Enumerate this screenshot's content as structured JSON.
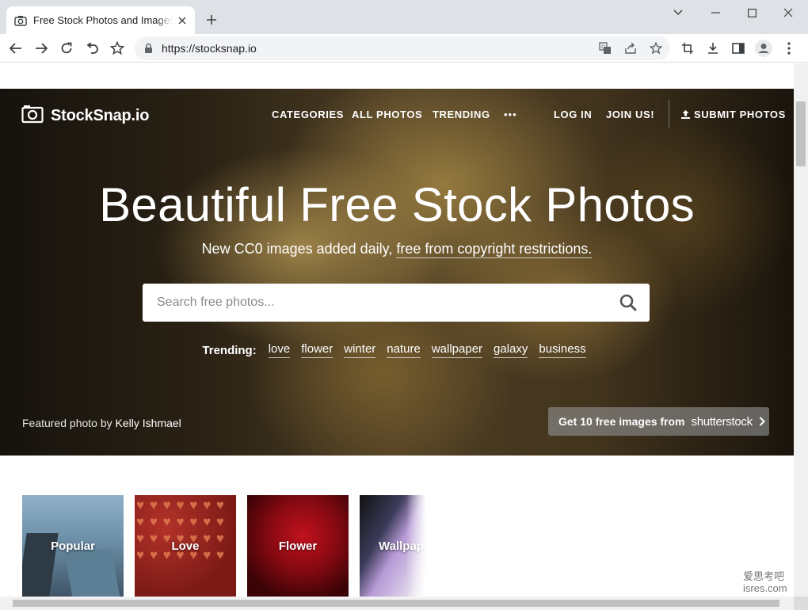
{
  "browser": {
    "tab_title": "Free Stock Photos and Images",
    "url": "https://stocksnap.io"
  },
  "site": {
    "logo_text": "StockSnap.io",
    "nav": {
      "categories": "CATEGORIES",
      "all_photos": "ALL PHOTOS",
      "trending": "TRENDING",
      "more": "•••",
      "log_in": "LOG IN",
      "join": "JOIN US!",
      "submit": "SUBMIT PHOTOS"
    },
    "hero": {
      "headline": "Beautiful Free Stock Photos",
      "sub_prefix": "New CC0 images added daily, ",
      "sub_link": "free from copyright restrictions.",
      "search_placeholder": "Search free photos...",
      "trending_label": "Trending:",
      "trending_terms": [
        "love",
        "flower",
        "winter",
        "nature",
        "wallpaper",
        "galaxy",
        "business"
      ],
      "featured_prefix": "Featured photo by ",
      "featured_author": "Kelly Ishmael",
      "promo_text": "Get 10 free images from",
      "promo_brand": "shutterstock"
    },
    "categories": [
      "Popular",
      "Love",
      "Flower",
      "Wallpaper"
    ]
  },
  "watermark": [
    "爱思考吧",
    "isres.com"
  ]
}
